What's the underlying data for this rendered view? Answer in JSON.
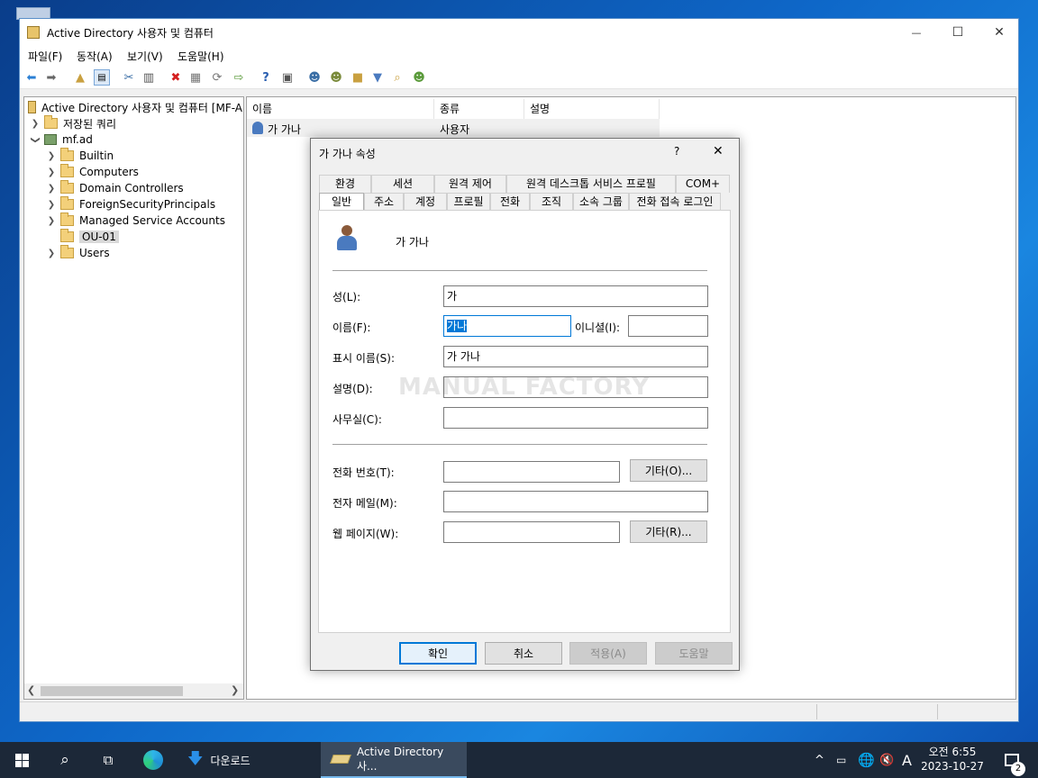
{
  "desktop": {
    "icon": "recycle-bin-icon"
  },
  "window": {
    "title": "Active Directory 사용자 및 컴퓨터",
    "controls": {
      "minimize": "—",
      "maximize": "☐",
      "close": "✕"
    }
  },
  "menu": [
    "파일(F)",
    "동작(A)",
    "보기(V)",
    "도움말(H)"
  ],
  "tree": {
    "root": "Active Directory 사용자 및 컴퓨터 [MF-A",
    "saved_queries": "저장된 쿼리",
    "domain": "mf.ad",
    "items": [
      "Builtin",
      "Computers",
      "Domain Controllers",
      "ForeignSecurityPrincipals",
      "Managed Service Accounts",
      "OU-01",
      "Users"
    ]
  },
  "list": {
    "columns": [
      "이름",
      "종류",
      "설명"
    ],
    "rows": [
      {
        "name": "가 가나",
        "type": "사용자",
        "desc": ""
      }
    ]
  },
  "dialog": {
    "title": "가 가나 속성",
    "help": "?",
    "close": "✕",
    "tabs_row1": [
      "환경",
      "세션",
      "원격 제어",
      "원격 데스크톱 서비스 프로필",
      "COM+"
    ],
    "tabs_row2": [
      "일반",
      "주소",
      "계정",
      "프로필",
      "전화",
      "조직",
      "소속 그룹",
      "전화 접속 로그인"
    ],
    "active_tab": "일반",
    "user_display": "가 가나",
    "fields": {
      "last_name_label": "성(L):",
      "last_name": "가",
      "first_name_label": "이름(F):",
      "first_name": "가나",
      "initials_label": "이니셜(I):",
      "initials": "",
      "display_name_label": "표시 이름(S):",
      "display_name": "가 가나",
      "description_label": "설명(D):",
      "description": "",
      "office_label": "사무실(C):",
      "office": "",
      "phone_label": "전화 번호(T):",
      "phone": "",
      "email_label": "전자 메일(M):",
      "email": "",
      "web_label": "웹 페이지(W):",
      "web": ""
    },
    "other_phone_btn": "기타(O)...",
    "other_web_btn": "기타(R)...",
    "watermark": "MANUAL FACTORY",
    "buttons": {
      "ok": "확인",
      "cancel": "취소",
      "apply": "적용(A)",
      "help": "도움말"
    }
  },
  "taskbar": {
    "items": [
      {
        "label": "다운로드"
      },
      {
        "label": "Active Directory 사..."
      }
    ],
    "time": "오전 6:55",
    "date": "2023-10-27",
    "ime": "A",
    "notif_count": "2"
  },
  "colors": {
    "accent": "#0078d7",
    "taskbar": "#1c2838",
    "folder": "#f3d07a"
  }
}
